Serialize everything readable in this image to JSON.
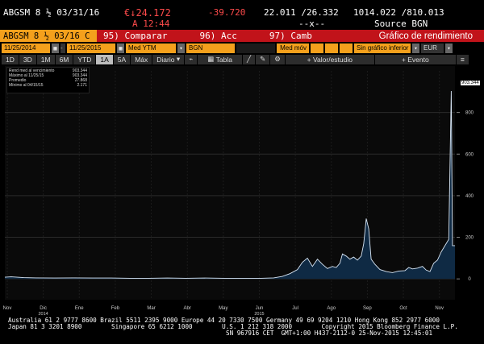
{
  "quote": {
    "ticker": "ABGSM 8 ½ 03/31/16",
    "price": "€↓24.172",
    "change": "-39.720",
    "bid_ask": "22.011 /26.332",
    "sizes": "1014.022 /810.013",
    "time": "A 12:44",
    "separator": "--x--",
    "source": "Source BGN"
  },
  "title_bar": {
    "ticker": "ABGSM 8 ½ 03/16 C",
    "items": [
      "95) Comparar",
      "96) Acc",
      "97) Camb"
    ],
    "title": "Gráfico de rendimiento"
  },
  "inputs": {
    "start_date": "11/25/2014",
    "end_date": "11/25/2015",
    "field": "Med YTM",
    "source": "BGN",
    "moving_label": "Med móv",
    "lower_chart": "Sin gráfico inferior",
    "currency": "EUR"
  },
  "toolbar": {
    "periods": [
      "1D",
      "3D",
      "1M",
      "6M",
      "YTD",
      "1A",
      "5A",
      "Máx"
    ],
    "active_period": "1A",
    "frequency": "Diario",
    "table_label": "Tabla",
    "value_label": "Valor/estudio",
    "event_label": "Evento"
  },
  "legend": {
    "rows": [
      {
        "label": "Rend med al vencimiento",
        "value": "903.344"
      },
      {
        "label": "Máximo al 11/25/15",
        "value": "903.344"
      },
      {
        "label": "Promedio",
        "value": "27.868"
      },
      {
        "label": "Mínimo al 04/15/15",
        "value": "2.171"
      }
    ]
  },
  "last_value": "903.344",
  "chart_data": {
    "type": "area",
    "x_labels": [
      "Nov",
      "Dic",
      "Ene",
      "Feb",
      "Mar",
      "Abr",
      "May",
      "Jun",
      "Jul",
      "Ago",
      "Sep",
      "Oct",
      "Nov"
    ],
    "year_labels": [
      {
        "label": "2014",
        "under": "Dic"
      },
      {
        "label": "2015",
        "under": "Jun"
      }
    ],
    "y_ticks": [
      0,
      200,
      400,
      600,
      800
    ],
    "ylim": [
      -100,
      1000
    ],
    "series": [
      {
        "name": "Rend med al vencimiento",
        "values": [
          [
            0,
            8
          ],
          [
            5,
            10
          ],
          [
            15,
            6
          ],
          [
            25,
            5
          ],
          [
            40,
            4
          ],
          [
            55,
            5
          ],
          [
            70,
            4
          ],
          [
            85,
            4
          ],
          [
            100,
            3
          ],
          [
            115,
            3
          ],
          [
            130,
            4
          ],
          [
            145,
            3
          ],
          [
            160,
            4
          ],
          [
            175,
            3
          ],
          [
            190,
            3
          ],
          [
            205,
            3
          ],
          [
            215,
            5
          ],
          [
            222,
            12
          ],
          [
            228,
            25
          ],
          [
            234,
            45
          ],
          [
            238,
            80
          ],
          [
            242,
            100
          ],
          [
            246,
            60
          ],
          [
            250,
            95
          ],
          [
            254,
            70
          ],
          [
            258,
            50
          ],
          [
            262,
            60
          ],
          [
            265,
            55
          ],
          [
            268,
            75
          ],
          [
            270,
            120
          ],
          [
            273,
            110
          ],
          [
            276,
            95
          ],
          [
            279,
            105
          ],
          [
            282,
            90
          ],
          [
            285,
            110
          ],
          [
            287,
            170
          ],
          [
            289,
            290
          ],
          [
            291,
            240
          ],
          [
            293,
            95
          ],
          [
            296,
            70
          ],
          [
            300,
            45
          ],
          [
            305,
            35
          ],
          [
            310,
            30
          ],
          [
            315,
            38
          ],
          [
            320,
            40
          ],
          [
            323,
            55
          ],
          [
            326,
            48
          ],
          [
            330,
            52
          ],
          [
            334,
            60
          ],
          [
            337,
            42
          ],
          [
            340,
            35
          ],
          [
            343,
            75
          ],
          [
            346,
            90
          ],
          [
            349,
            130
          ],
          [
            352,
            160
          ],
          [
            355,
            190
          ],
          [
            357,
            903.344
          ],
          [
            358,
            160
          ],
          [
            360,
            160
          ]
        ]
      }
    ],
    "x_domain": [
      0,
      360
    ],
    "grid": true
  },
  "footer": {
    "line1": "Australia 61 2 9777 8600 Brazil 5511 2395 9000 Europe 44 20 7330 7500 Germany 49 69 9204 1210 Hong Kong 852 2977 6000",
    "line2": "Japan 81 3 3201 8900        Singapore 65 6212 1000        U.S. 1 212 318 2000        Copyright 2015 Bloomberg Finance L.P.",
    "line3": "SN 967916 CET  GMT+1:00 H437-2112-0 25-Nov-2015 12:45:01"
  }
}
